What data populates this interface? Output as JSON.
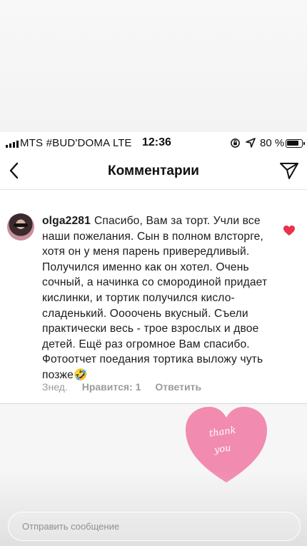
{
  "status_bar": {
    "carrier": "MTS #BUD'DOMA",
    "network": "LTE",
    "time": "12:36",
    "battery": "80 %"
  },
  "nav": {
    "title": "Комментарии"
  },
  "comment": {
    "username": "olga2281",
    "text": "Спасибо, Вам за торт. Учли все наши пожелания. Сын в полном влсторге, хотя он у меня парень привередливый. Получился именно как он хотел. Очень сочный, а начинка со смородиной придает кислинки, и тортик получился кисло- сладенький. Оооочень вкусный. Съели практически весь - трое взрослых и двое детей. Ещё раз огромное Вам спасибо. Фотоотчет поедания тортика выложу чуть позже🤣",
    "time": "Знед.",
    "likes": "Нравится: 1",
    "reply": "Ответить",
    "liked": true
  },
  "sticker": {
    "line1": "thank",
    "line2": "you"
  },
  "message_input": {
    "placeholder": "Отправить сообщение"
  },
  "colors": {
    "like_heart": "#e8334a",
    "sticker_heart": "#f28bb0",
    "meta_text": "#9b9b9b"
  },
  "icons": [
    "signal-icon",
    "back-arrow-icon",
    "share-icon",
    "heart-icon",
    "location-icon",
    "rotation-lock-icon",
    "battery-icon"
  ]
}
